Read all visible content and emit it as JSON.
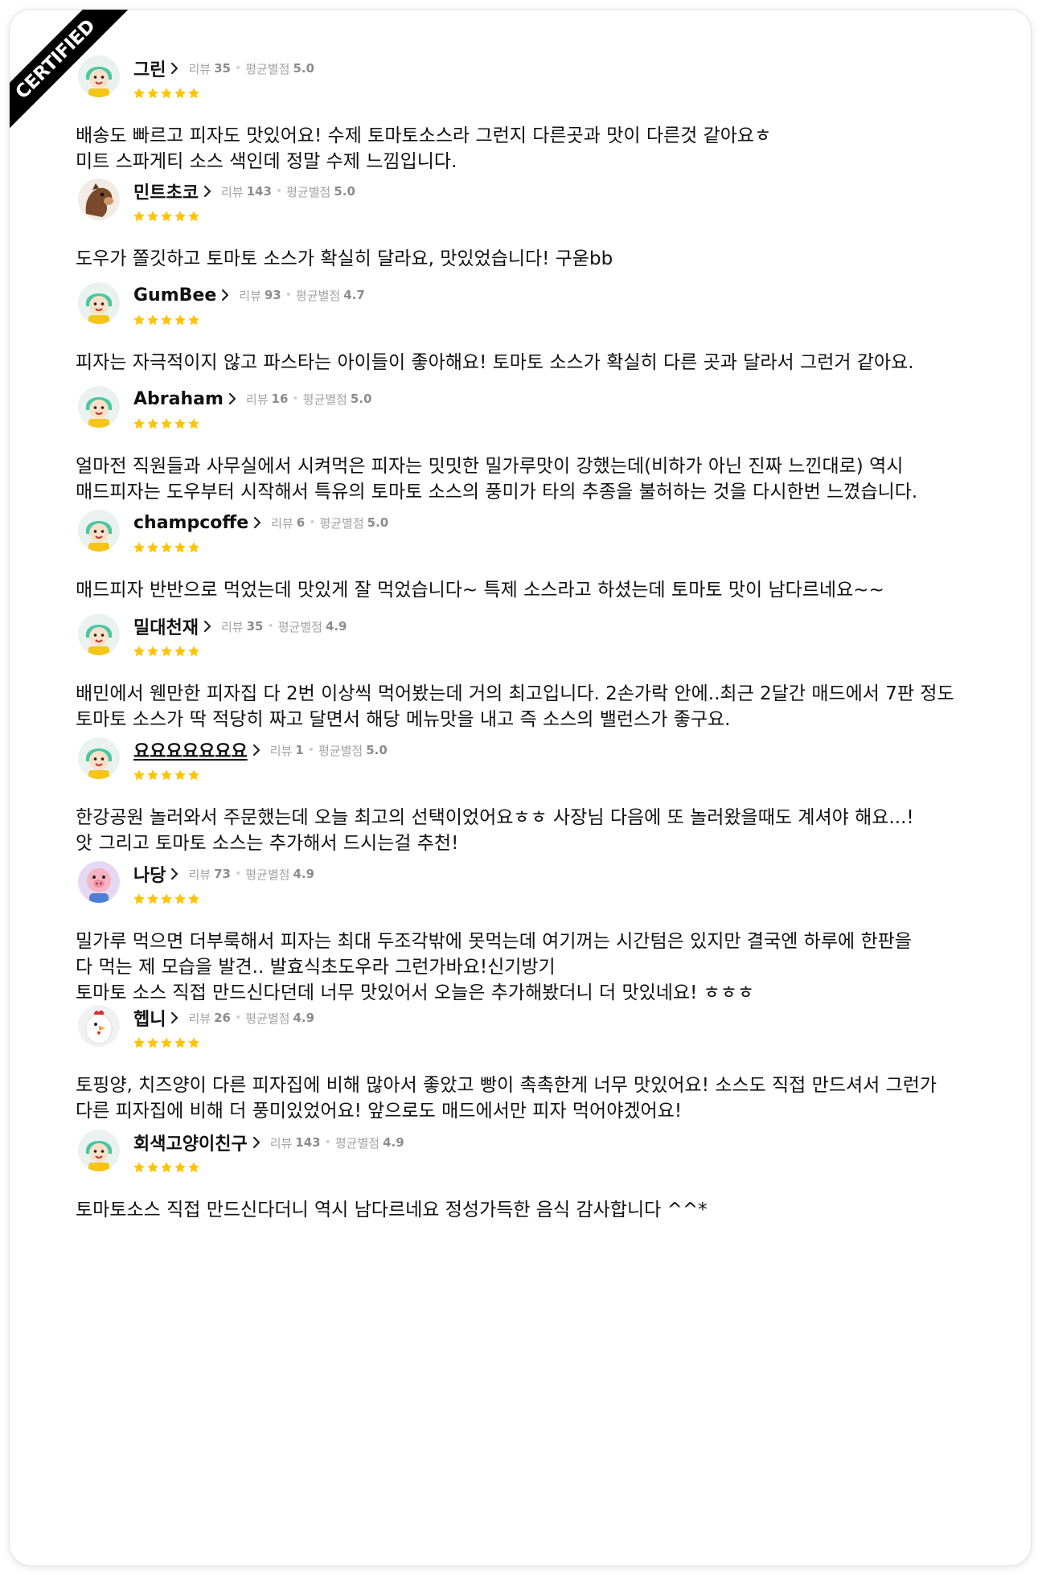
{
  "badge": "CERTIFIED",
  "labels": {
    "reviews": "리뷰",
    "avg_rating": "평균별점"
  },
  "colors": {
    "star": "#FFC400",
    "meta": "#A3A3A3"
  },
  "reviews": [
    {
      "name": "그린",
      "review_count": "35",
      "avg_rating": "5.0",
      "stars": 5,
      "avatar_icon": "cartoon-avatar-icon",
      "text": "배송도 빠르고 피자도 맛있어요! 수제 토마토소스라 그런지 다른곳과 맛이 다른것 같아요ㅎ\n미트 스파게티 소스 색인데 정말 수제 느낌입니다."
    },
    {
      "name": "민트초코",
      "review_count": "143",
      "avg_rating": "5.0",
      "stars": 5,
      "avatar_icon": "horse-avatar-icon",
      "text": "도우가 쫄깃하고 토마토 소스가 확실히 달라요, 맛있었습니다! 구욷bb"
    },
    {
      "name": "GumBee",
      "review_count": "93",
      "avg_rating": "4.7",
      "stars": 5,
      "avatar_icon": "cartoon-avatar-icon",
      "text": "피자는 자극적이지 않고 파스타는 아이들이 좋아해요! 토마토 소스가 확실히 다른 곳과 달라서 그런거 같아요."
    },
    {
      "name": "Abraham",
      "review_count": "16",
      "avg_rating": "5.0",
      "stars": 5,
      "avatar_icon": "cartoon-avatar-icon",
      "text": "얼마전 직원들과 사무실에서 시켜먹은 피자는 밋밋한 밀가루맛이 강했는데(비하가 아닌 진짜 느낀대로) 역시\n매드피자는 도우부터 시작해서 특유의 토마토 소스의 풍미가 타의 추종을 불허하는 것을 다시한번 느꼈습니다."
    },
    {
      "name": "champcoffe",
      "review_count": "6",
      "avg_rating": "5.0",
      "stars": 5,
      "avatar_icon": "cartoon-avatar-icon",
      "text": "매드피자 반반으로 먹었는데 맛있게 잘 먹었습니다~ 특제 소스라고 하셨는데 토마토 맛이 남다르네요~~"
    },
    {
      "name": "밀대천재",
      "review_count": "35",
      "avg_rating": "4.9",
      "stars": 5,
      "avatar_icon": "cartoon-avatar-icon",
      "text": "배민에서 웬만한 피자집 다 2번 이상씩 먹어봤는데 거의 최고입니다. 2손가락 안에..최근 2달간 매드에서 7판 정도\n토마토 소스가 딱 적당히 짜고 달면서 해당 메뉴맛을 내고 즉 소스의 밸런스가 좋구요."
    },
    {
      "name": "요요요요요요요",
      "review_count": "1",
      "avg_rating": "5.0",
      "stars": 5,
      "avatar_icon": "cartoon-avatar-icon",
      "text": "한강공원 놀러와서 주문했는데 오늘 최고의 선택이었어요ㅎㅎ 사장님 다음에 또 놀러왔을때도 계셔야 해요...!\n앗 그리고 토마토 소스는 추가해서 드시는걸 추천!"
    },
    {
      "name": "나당",
      "review_count": "73",
      "avg_rating": "4.9",
      "stars": 5,
      "avatar_icon": "pig-avatar-icon",
      "text": "밀가루 먹으면 더부룩해서 피자는 최대 두조각밖에 못먹는데 여기꺼는 시간텀은 있지만 결국엔 하루에 한판을\n다 먹는 제 모습을 발견.. 발효식초도우라 그런가바요!신기방기\n토마토 소스 직접 만드신다던데 너무 맛있어서 오늘은 추가해봤더니 더 맛있네요! ㅎㅎㅎ"
    },
    {
      "name": "헵니",
      "review_count": "26",
      "avg_rating": "4.9",
      "stars": 5,
      "avatar_icon": "chicken-avatar-icon",
      "text": "토핑양, 치즈양이 다른 피자집에 비해 많아서 좋았고 빵이 촉촉한게 너무 맛있어요! 소스도 직접 만드셔서 그런가\n다른 피자집에 비해 더 풍미있었어요! 앞으로도 매드에서만 피자 먹어야겠어요!"
    },
    {
      "name": "회색고양이친구",
      "review_count": "143",
      "avg_rating": "4.9",
      "stars": 5,
      "avatar_icon": "cartoon-avatar-icon",
      "text": "토마토소스 직접 만드신다더니 역시 남다르네요 정성가득한 음식 감사합니다 ^^*"
    }
  ]
}
